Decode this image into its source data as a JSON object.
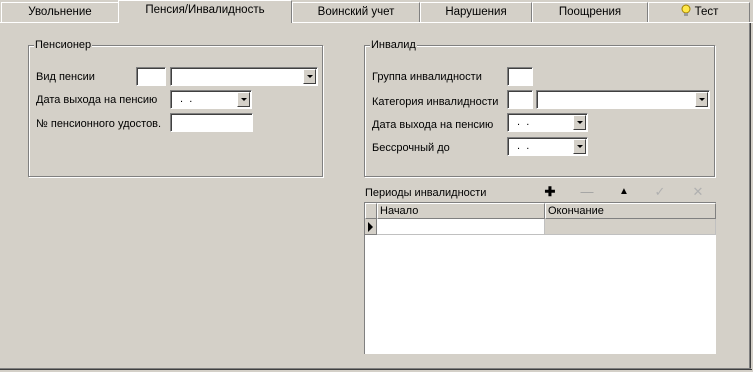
{
  "tabs": [
    {
      "label": "Увольнение",
      "active": false
    },
    {
      "label": "Пенсия/Инвалидность",
      "active": true
    },
    {
      "label": "Воинский учет",
      "active": false
    },
    {
      "label": "Нарушения",
      "active": false
    },
    {
      "label": "Поощрения",
      "active": false
    },
    {
      "label": "Тест",
      "active": false,
      "icon": "lightbulb-icon"
    }
  ],
  "pensioner": {
    "title": "Пенсионер",
    "pension_type_label": "Вид пенсии",
    "pension_type_code": "",
    "pension_type_value": "",
    "retirement_date_label": "Дата выхода на пенсию",
    "retirement_date_value": " .  .",
    "certificate_label": "№ пенсионного удостов.",
    "certificate_value": ""
  },
  "invalid": {
    "title": "Инвалид",
    "group_label": "Группа инвалидности",
    "group_value": "",
    "category_label": "Категория инвалидности",
    "category_code": "",
    "category_value": "",
    "retirement_date_label": "Дата выхода на пенсию",
    "retirement_date_value": " .  .",
    "indefinite_until_label": "Бессрочный до",
    "indefinite_until_value": " .  ."
  },
  "periods": {
    "title": "Периоды инвалидности",
    "toolbar": [
      {
        "name": "add-icon",
        "glyph": "✚"
      },
      {
        "name": "delete-icon",
        "glyph": "—"
      },
      {
        "name": "up-icon",
        "glyph": "▲"
      },
      {
        "name": "confirm-icon",
        "glyph": "✓"
      },
      {
        "name": "cancel-icon",
        "glyph": "✕"
      }
    ],
    "columns": [
      "Начало",
      "Окончание"
    ],
    "rows": [
      [
        "",
        ""
      ]
    ]
  }
}
